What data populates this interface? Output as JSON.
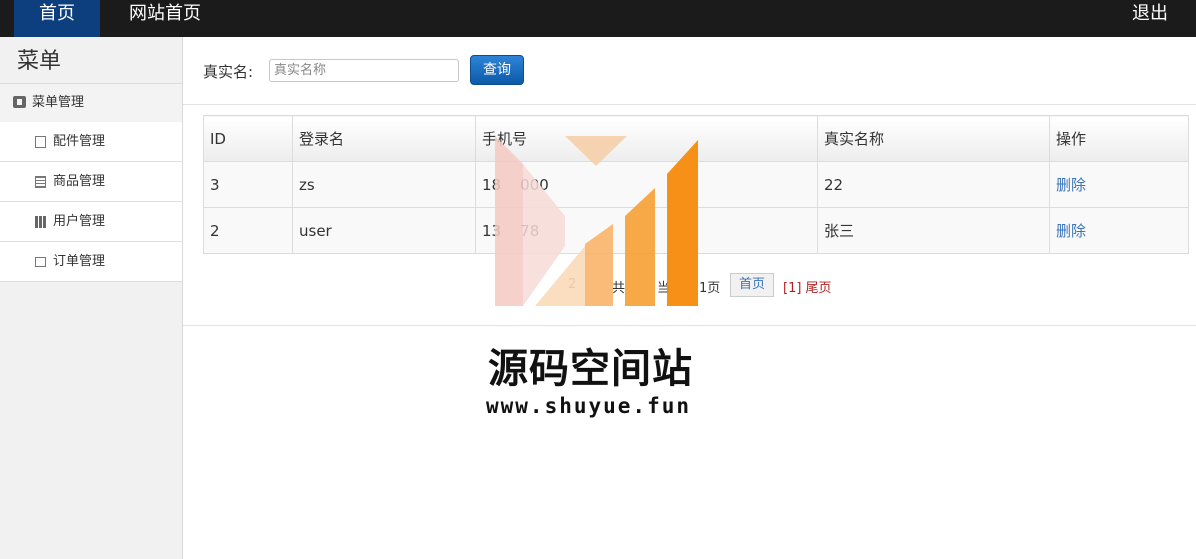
{
  "topnav": {
    "home": "首页",
    "site_home": "网站首页",
    "logout": "退出"
  },
  "sidebar": {
    "title": "菜单",
    "group": {
      "label": "菜单管理",
      "icon": "book-icon"
    },
    "items": [
      {
        "label": "配件管理",
        "icon": "file-icon"
      },
      {
        "label": "商品管理",
        "icon": "list-icon"
      },
      {
        "label": "用户管理",
        "icon": "books-icon"
      },
      {
        "label": "订单管理",
        "icon": "envelope-icon"
      }
    ]
  },
  "search": {
    "label": "真实名:",
    "placeholder": "真实名称",
    "value": "",
    "button": "查询"
  },
  "table": {
    "columns": [
      "ID",
      "登录名",
      "手机号",
      "真实名称",
      "操作"
    ],
    "rows": [
      {
        "id": "3",
        "login": "zs",
        "phone": "18    000",
        "realname": "22",
        "action": "删除"
      },
      {
        "id": "2",
        "login": "user",
        "phone": "13    78",
        "realname": "张三",
        "action": "删除"
      }
    ]
  },
  "pager": {
    "text_left": "2",
    "text_mid": "共",
    "text_mid2": "当",
    "text_right": "1页",
    "first": "首页",
    "current": "[1] 尾页"
  },
  "watermark": {
    "title": "源码空间站",
    "url": "www.shuyue.fun"
  },
  "colors": {
    "topbar": "#1b1b1b",
    "nav_active": "#0d3f7e",
    "button": "#0c5aa8",
    "link": "#3a74b8",
    "watermark_orange": "#f58a0b",
    "watermark_pink": "#f4c9c2"
  }
}
